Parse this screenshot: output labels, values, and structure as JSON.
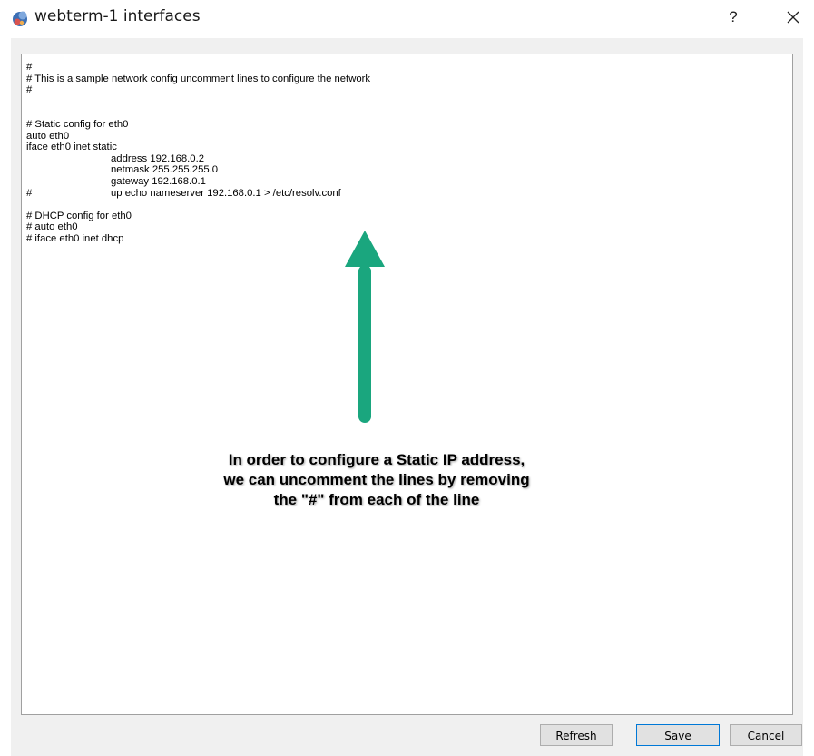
{
  "window": {
    "title": "webterm-1 interfaces",
    "help_label": "?",
    "icon": "app-icon"
  },
  "editor": {
    "lines": [
      {
        "prefix": "",
        "text": "#"
      },
      {
        "prefix": "",
        "text": "# This is a sample network config uncomment lines to configure the network"
      },
      {
        "prefix": "",
        "text": "#"
      },
      {
        "prefix": "",
        "text": ""
      },
      {
        "prefix": "",
        "text": ""
      },
      {
        "prefix": "",
        "text": "# Static config for eth0"
      },
      {
        "prefix": "",
        "text": "auto eth0"
      },
      {
        "prefix": "",
        "text": "iface eth0 inet static"
      },
      {
        "prefix": "",
        "tabbed": true,
        "text": "address 192.168.0.2"
      },
      {
        "prefix": "",
        "tabbed": true,
        "text": "netmask 255.255.255.0"
      },
      {
        "prefix": "",
        "tabbed": true,
        "text": "gateway 192.168.0.1"
      },
      {
        "prefix": "#",
        "tabbed": true,
        "text": "up echo nameserver 192.168.0.1 > /etc/resolv.conf"
      },
      {
        "prefix": "",
        "text": ""
      },
      {
        "prefix": "",
        "text": "# DHCP config for eth0"
      },
      {
        "prefix": "",
        "text": "# auto eth0"
      },
      {
        "prefix": "",
        "text": "# iface eth0 inet dhcp"
      }
    ]
  },
  "annotation": {
    "lines": [
      "In order to configure a Static IP address,",
      "we can uncomment the lines by removing",
      "the \"#\" from each of the line"
    ],
    "arrow_color": "#1aa67e"
  },
  "buttons": {
    "refresh": "Refresh",
    "save": "Save",
    "cancel": "Cancel"
  }
}
